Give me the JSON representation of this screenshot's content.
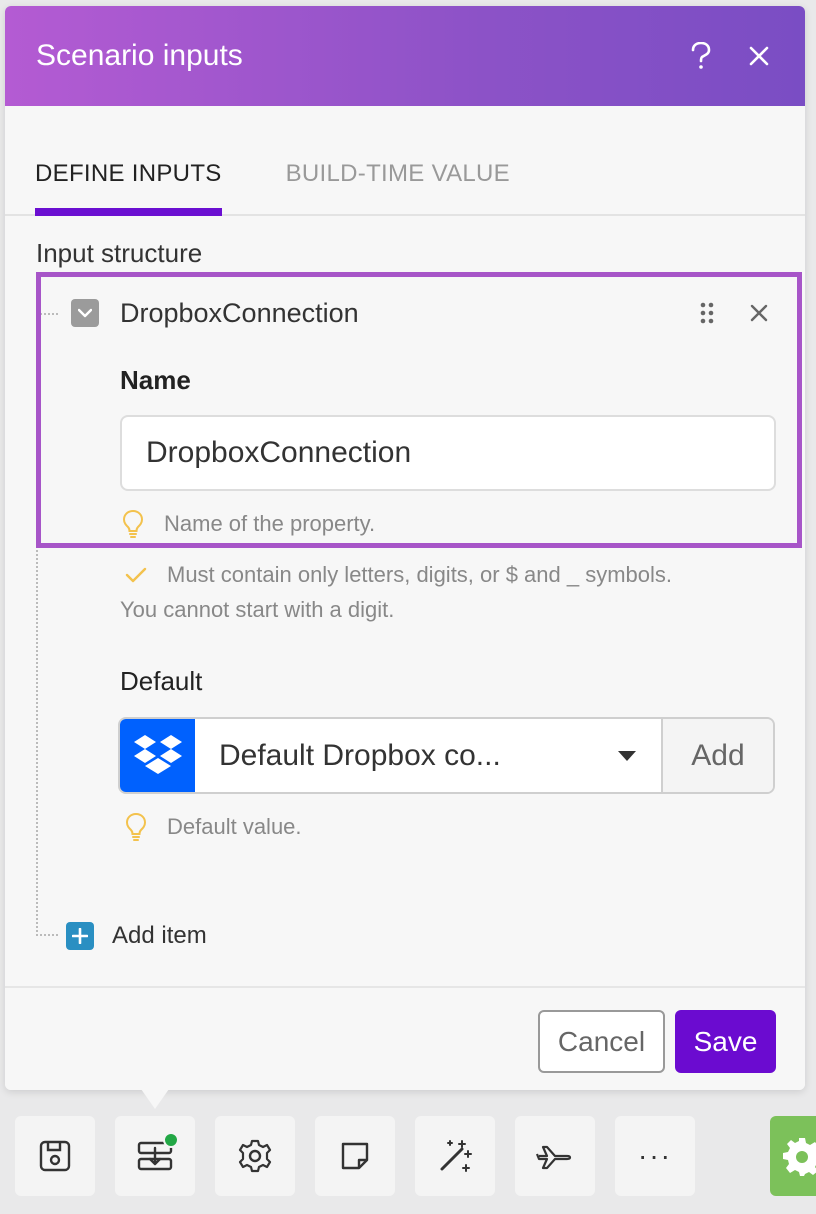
{
  "dialog": {
    "title": "Scenario inputs",
    "help_icon": "question-icon",
    "close_icon": "close-icon"
  },
  "tabs": [
    {
      "label": "DEFINE INPUTS",
      "active": true
    },
    {
      "label": "BUILD-TIME VALUE",
      "active": false
    }
  ],
  "input_structure": {
    "label": "Input structure",
    "item": {
      "title": "DropboxConnection",
      "name_label": "Name",
      "name_value": "DropboxConnection",
      "name_hint": "Name of the property.",
      "validation_line1": "Must contain only letters, digits, or $ and _ symbols.",
      "validation_line2": "You cannot start with a digit.",
      "default_label": "Default",
      "default_value": "Default Dropbox co...",
      "add_label": "Add",
      "default_hint": "Default value."
    },
    "add_item_label": "Add item"
  },
  "footer": {
    "cancel_label": "Cancel",
    "save_label": "Save"
  },
  "toolbar": {
    "buttons": [
      "save-icon",
      "scenario-inputs-icon",
      "gear-icon",
      "note-icon",
      "magic-wand-icon",
      "airplane-icon",
      "more-icon"
    ],
    "more_label": "···",
    "active_index": 1,
    "status_dot_color": "#22a745"
  },
  "colors": {
    "accent": "#6b0bd0",
    "header_gradient_start": "#b45bd3",
    "header_gradient_end": "#7a4dc4",
    "item_border": "#a755c8",
    "dropbox_blue": "#0061fe",
    "run_green": "#7cc15a"
  }
}
